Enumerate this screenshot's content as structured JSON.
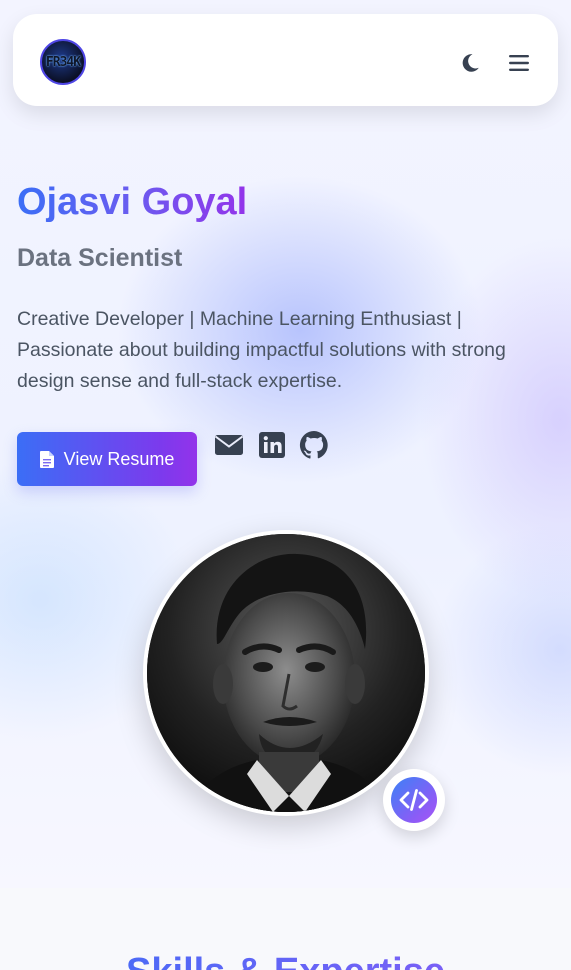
{
  "navbar": {
    "logo_text": "FR34K",
    "theme_icon": "moon-icon",
    "menu_icon": "hamburger-menu-icon"
  },
  "hero": {
    "name": "Ojasvi Goyal",
    "role": "Data Scientist",
    "bio": "Creative Developer | Machine Learning Enthusiast | Passionate about building impactful solutions with strong design sense and full-stack expertise.",
    "resume_button": {
      "label": "View Resume",
      "icon": "document-icon"
    },
    "social_links": [
      {
        "icon": "envelope-icon",
        "label": "Email"
      },
      {
        "icon": "linkedin-icon",
        "label": "LinkedIn"
      },
      {
        "icon": "github-icon",
        "label": "GitHub"
      }
    ],
    "profile_badge_icon": "code-icon"
  },
  "skills_section": {
    "title": "Skills & Expertise"
  },
  "colors": {
    "accent_blue": "#3b6ef6",
    "accent_purple": "#9333ea",
    "text_muted": "#6b7280",
    "icon_dark": "#374151"
  }
}
